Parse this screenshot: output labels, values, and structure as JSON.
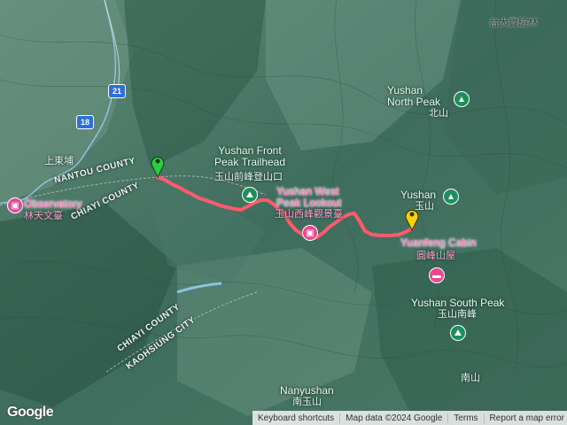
{
  "map": {
    "labels": {
      "north_peak": "Yushan\nNorth Peak",
      "north_peak_zh": "北山",
      "front_peak": "Yushan Front\nPeak Trailhead",
      "front_peak_zh": "玉山前峰登山口",
      "west_peak": "Yushan West\nPeak Lookout",
      "west_peak_zh": "玉山西峰觀景臺",
      "yushan": "Yushan",
      "yushan_zh": "玉山",
      "yuanfeng": "Yuanfeng Cabin",
      "yuanfeng_zh": "圓峰山屋",
      "south_peak": "Yushan South Peak",
      "south_peak_zh": "玉山南峰",
      "nanyushan": "Nanyushan",
      "nanyushan_zh": "南玉山",
      "nanshan": "南山",
      "observatory": "Observatory",
      "observatory_zh": "林天文臺",
      "shangdongpu": "上東埔",
      "tai_da": "台大實驗林",
      "nantou_county": "NANTOU COUNTY",
      "chiayi_county": "CHIAYI COUNTY",
      "chiayi_county_2": "CHIAYI COUNTY",
      "kaohsiung_city": "KAOHSIUNG CITY"
    },
    "road_shields": {
      "r21": "21",
      "r18": "18"
    },
    "colors": {
      "route": "#ff5a6e",
      "start_marker": "#2ecc40",
      "end_marker": "#f5d20a"
    }
  },
  "footer": {
    "keyboard": "Keyboard shortcuts",
    "data": "Map data ©2024 Google",
    "terms": "Terms",
    "report": "Report a map error"
  },
  "logo": "Google"
}
